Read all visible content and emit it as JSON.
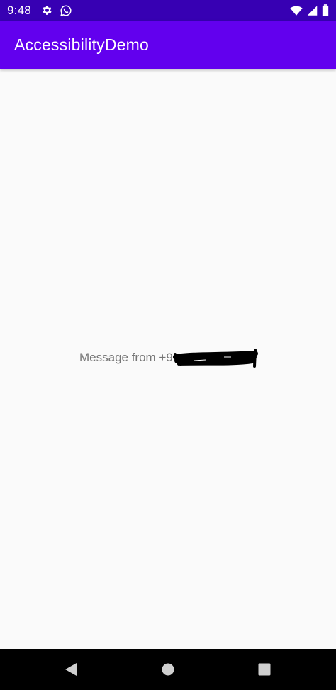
{
  "status_bar": {
    "time": "9:48",
    "left_icons": [
      "gear-icon",
      "whatsapp-icon"
    ],
    "right_icons": [
      "wifi-icon",
      "cellular-signal-icon",
      "battery-icon"
    ]
  },
  "app_bar": {
    "title": "AccessibilityDemo"
  },
  "content": {
    "message_label": "Message from +9"
  },
  "navigation_bar": {
    "buttons": [
      "back-icon",
      "home-icon",
      "recents-icon"
    ]
  },
  "colors": {
    "status_bar": "#3700b3",
    "app_bar": "#6200ee",
    "background": "#fafafa",
    "message_text": "#757575",
    "navigation_bar": "#000000"
  }
}
